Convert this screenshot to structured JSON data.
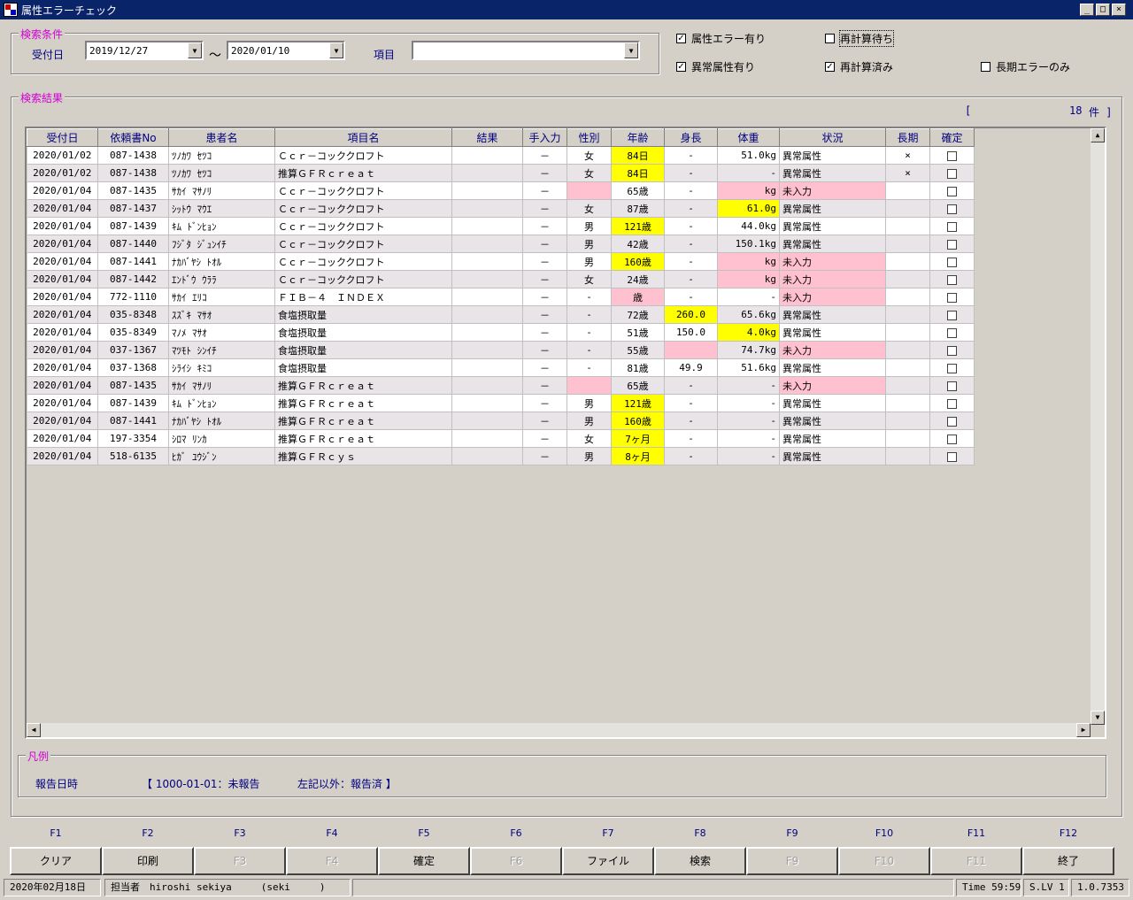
{
  "window": {
    "title": "属性エラーチェック",
    "min": "_",
    "max": "□",
    "close": "×"
  },
  "search": {
    "group_title": "検索条件",
    "date_label": "受付日",
    "date_from": "2019/12/27",
    "tilde": "～",
    "date_to": "2020/01/10",
    "item_label": "項目",
    "item_value": ""
  },
  "options": {
    "attr_error": {
      "label": "属性エラー有り",
      "checked": "✓"
    },
    "recalc_wait": {
      "label": "再計算待ち",
      "checked": ""
    },
    "abnormal_attr": {
      "label": "異常属性有り",
      "checked": "✓"
    },
    "recalc_done": {
      "label": "再計算済み",
      "checked": "✓"
    },
    "long_only": {
      "label": "長期エラーのみ",
      "checked": ""
    }
  },
  "results": {
    "group_title": "検索結果",
    "bracket_open": "[",
    "count": "18",
    "count_suffix": "件 ]",
    "columns": [
      "受付日",
      "依頼書No",
      "患者名",
      "項目名",
      "結果",
      "手入力",
      "性別",
      "年齢",
      "身長",
      "体重",
      "状況",
      "長期",
      "確定"
    ],
    "rows": [
      [
        "2020/01/02",
        "087-1438",
        "ﾂﾉｶﾜ ｾﾂｺ",
        "Ｃｃｒ－コッククロフト",
        "",
        "－",
        "女",
        "84日",
        "-",
        "51.0kg",
        "異常属性",
        "×",
        ""
      ],
      [
        "2020/01/02",
        "087-1438",
        "ﾂﾉｶﾜ ｾﾂｺ",
        "推算ＧＦＲｃｒｅａｔ",
        "",
        "－",
        "女",
        "84日",
        "-",
        "-",
        "異常属性",
        "×",
        ""
      ],
      [
        "2020/01/04",
        "087-1435",
        "ｻｶｲ ﾏｻﾉﾘ",
        "Ｃｃｒ－コッククロフト",
        "",
        "－",
        "",
        "65歳",
        "-",
        "kg",
        "未入力",
        "",
        ""
      ],
      [
        "2020/01/04",
        "087-1437",
        "ｼｯﾄｳ ﾏｳｴ",
        "Ｃｃｒ－コッククロフト",
        "",
        "－",
        "女",
        "87歳",
        "-",
        "61.0g",
        "異常属性",
        "",
        ""
      ],
      [
        "2020/01/04",
        "087-1439",
        "ｷﾑ ﾄﾞﾝﾋｮﾝ",
        "Ｃｃｒ－コッククロフト",
        "",
        "－",
        "男",
        "121歳",
        "-",
        "44.0kg",
        "異常属性",
        "",
        ""
      ],
      [
        "2020/01/04",
        "087-1440",
        "ﾌｼﾞﾀ ｼﾞｭﾝｲﾁ",
        "Ｃｃｒ－コッククロフト",
        "",
        "－",
        "男",
        "42歳",
        "-",
        "150.1kg",
        "異常属性",
        "",
        ""
      ],
      [
        "2020/01/04",
        "087-1441",
        "ﾅｶﾊﾞﾔｼ ﾄｵﾙ",
        "Ｃｃｒ－コッククロフト",
        "",
        "－",
        "男",
        "160歳",
        "-",
        "kg",
        "未入力",
        "",
        ""
      ],
      [
        "2020/01/04",
        "087-1442",
        "ｴﾝﾄﾞｳ ｳﾗﾗ",
        "Ｃｃｒ－コッククロフト",
        "",
        "－",
        "女",
        "24歳",
        "-",
        "kg",
        "未入力",
        "",
        ""
      ],
      [
        "2020/01/04",
        "772-1110",
        "ｻｶｲ ｴﾘｺ",
        "ＦＩＢ－４　ＩＮＤＥＸ",
        "",
        "－",
        "-",
        "歳",
        "-",
        "-",
        "未入力",
        "",
        ""
      ],
      [
        "2020/01/04",
        "035-8348",
        "ｽｽﾞｷ ﾏｻｵ",
        "食塩摂取量",
        "",
        "－",
        "-",
        "72歳",
        "260.0",
        "65.6kg",
        "異常属性",
        "",
        ""
      ],
      [
        "2020/01/04",
        "035-8349",
        "ﾏﾉﾒ ﾏｻｵ",
        "食塩摂取量",
        "",
        "－",
        "-",
        "51歳",
        "150.0",
        "4.0kg",
        "異常属性",
        "",
        ""
      ],
      [
        "2020/01/04",
        "037-1367",
        "ﾏﾂﾓﾄ ｼﾝｲﾁ",
        "食塩摂取量",
        "",
        "－",
        "-",
        "55歳",
        "",
        "74.7kg",
        "未入力",
        "",
        ""
      ],
      [
        "2020/01/04",
        "037-1368",
        "ｼﾗｲｼ ｷﾐｺ",
        "食塩摂取量",
        "",
        "－",
        "-",
        "81歳",
        "49.9",
        "51.6kg",
        "異常属性",
        "",
        ""
      ],
      [
        "2020/01/04",
        "087-1435",
        "ｻｶｲ ﾏｻﾉﾘ",
        "推算ＧＦＲｃｒｅａｔ",
        "",
        "－",
        "",
        "65歳",
        "-",
        "-",
        "未入力",
        "",
        ""
      ],
      [
        "2020/01/04",
        "087-1439",
        "ｷﾑ ﾄﾞﾝﾋｮﾝ",
        "推算ＧＦＲｃｒｅａｔ",
        "",
        "－",
        "男",
        "121歳",
        "-",
        "-",
        "異常属性",
        "",
        ""
      ],
      [
        "2020/01/04",
        "087-1441",
        "ﾅｶﾊﾞﾔｼ ﾄｵﾙ",
        "推算ＧＦＲｃｒｅａｔ",
        "",
        "－",
        "男",
        "160歳",
        "-",
        "-",
        "異常属性",
        "",
        ""
      ],
      [
        "2020/01/04",
        "197-3354",
        "ｼﾛﾏ ﾘﾝｶ",
        "推算ＧＦＲｃｒｅａｔ",
        "",
        "－",
        "女",
        "7ヶ月",
        "-",
        "-",
        "異常属性",
        "",
        ""
      ],
      [
        "2020/01/04",
        "518-6135",
        "ﾋｶﾞ ﾕｳｼﾞﾝ",
        "推算ＧＦＲｃｙｓ",
        "",
        "－",
        "男",
        "8ヶ月",
        "-",
        "-",
        "異常属性",
        "",
        ""
      ]
    ],
    "highlights": [
      {
        "row": 0,
        "age": "yellow"
      },
      {
        "row": 1,
        "age": "yellow"
      },
      {
        "row": 2,
        "sex": "pink",
        "weight": "pink",
        "status": "pink"
      },
      {
        "row": 3,
        "weight": "yellow"
      },
      {
        "row": 4,
        "age": "yellow"
      },
      {
        "row": 5
      },
      {
        "row": 6,
        "age": "yellow",
        "weight": "pink",
        "status": "pink"
      },
      {
        "row": 7,
        "weight": "pink",
        "status": "pink"
      },
      {
        "row": 8,
        "age": "pink",
        "status": "pink"
      },
      {
        "row": 9,
        "height": "yellow"
      },
      {
        "row": 10,
        "weight": "yellow"
      },
      {
        "row": 11,
        "height": "pink",
        "status": "pink"
      },
      {
        "row": 12
      },
      {
        "row": 13,
        "sex": "pink",
        "status": "pink"
      },
      {
        "row": 14,
        "age": "yellow"
      },
      {
        "row": 15,
        "age": "yellow"
      },
      {
        "row": 16,
        "age": "yellow"
      },
      {
        "row": 17,
        "age": "yellow"
      }
    ]
  },
  "legend": {
    "group_title": "凡例",
    "label": "報告日時",
    "text1": "【 1000-01-01：未報告",
    "text2": "左記以外：報告済 】"
  },
  "fkeys": [
    {
      "key": "F1",
      "label": "クリア",
      "enabled": true
    },
    {
      "key": "F2",
      "label": "印刷",
      "enabled": true
    },
    {
      "key": "F3",
      "label": "F3",
      "enabled": false
    },
    {
      "key": "F4",
      "label": "F4",
      "enabled": false
    },
    {
      "key": "F5",
      "label": "確定",
      "enabled": true
    },
    {
      "key": "F6",
      "label": "F6",
      "enabled": false
    },
    {
      "key": "F7",
      "label": "ファイル",
      "enabled": true
    },
    {
      "key": "F8",
      "label": "検索",
      "enabled": true
    },
    {
      "key": "F9",
      "label": "F9",
      "enabled": false
    },
    {
      "key": "F10",
      "label": "F10",
      "enabled": false
    },
    {
      "key": "F11",
      "label": "F11",
      "enabled": false
    },
    {
      "key": "F12",
      "label": "終了",
      "enabled": true
    }
  ],
  "statusbar": {
    "date": "2020年02月18日",
    "user": "担当者　hiroshi sekiya　　　(seki　　　)",
    "time": "Time 59:59",
    "level": "S.LV 1",
    "version": "1.0.7353"
  },
  "colors": {
    "accent_label": "#000080",
    "group_title": "#d000d0",
    "highlight_yellow": "#ffff00",
    "highlight_pink": "#ffc0d0",
    "titlebar": "#0a246a"
  }
}
